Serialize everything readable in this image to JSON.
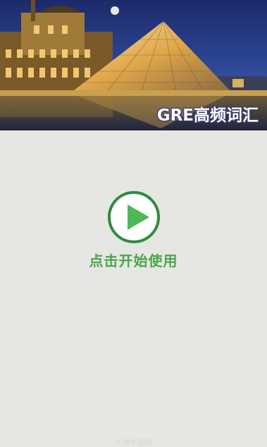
{
  "banner": {
    "title": "GRE高频词汇"
  },
  "start": {
    "label": "点击开始使用"
  },
  "watermark": {
    "text": "天地手游网"
  },
  "colors": {
    "background": "#e6e6e2",
    "accent_green": "#4aa54e",
    "play_ring": "#2e8b3e"
  },
  "icons": {
    "play": "play-icon",
    "moon": "moon-icon"
  }
}
